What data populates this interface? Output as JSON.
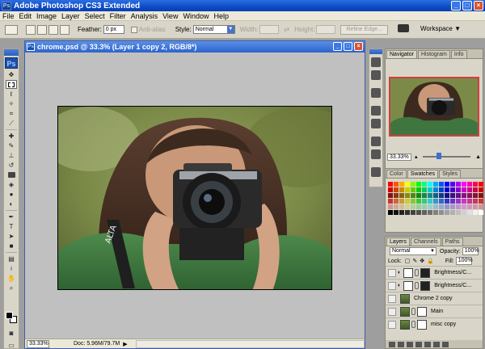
{
  "app": {
    "title": "Adobe Photoshop CS3 Extended",
    "icon": "ps-icon"
  },
  "window_buttons": {
    "minimize": "_",
    "maximize": "□",
    "close": "×"
  },
  "menu": [
    "File",
    "Edit",
    "Image",
    "Layer",
    "Select",
    "Filter",
    "Analysis",
    "View",
    "Window",
    "Help"
  ],
  "options_bar": {
    "feather_label": "Feather:",
    "feather_value": "0 px",
    "antialias_label": "Anti-alias",
    "style_label": "Style:",
    "style_value": "Normal",
    "width_label": "Width:",
    "height_label": "Height:",
    "refine_edge": "Refine Edge...",
    "workspace_label": "Workspace ▼"
  },
  "toolbox": {
    "logo": "Ps"
  },
  "document": {
    "title": "chrome.psd @ 33.3% (Layer 1 copy 2, RGB/8*)",
    "zoom": "33.33%",
    "doc_info": "Doc: 5.96M/79.7M"
  },
  "navigator_panel": {
    "tabs": [
      "Navigator",
      "Histogram",
      "Info"
    ],
    "active_tab": "Navigator",
    "zoom": "33.33%"
  },
  "swatches_panel": {
    "tabs": [
      "Color",
      "Swatches",
      "Styles"
    ],
    "active_tab": "Swatches"
  },
  "layers_panel": {
    "tabs": [
      "Layers",
      "Channels",
      "Paths"
    ],
    "active_tab": "Layers",
    "blend_mode": "Normal",
    "opacity_label": "Opacity:",
    "opacity_value": "100%",
    "lock_label": "Lock:",
    "fill_label": "Fill:",
    "fill_value": "100%",
    "layers": [
      {
        "name": "Brightness/C..."
      },
      {
        "name": "Brightness/C..."
      },
      {
        "name": "Chrome 2 copy"
      },
      {
        "name": "Main"
      },
      {
        "name": "misc copy"
      }
    ]
  },
  "colors": {
    "title_bar": "#0d4bc8",
    "panel_bg": "#d9d6c9",
    "canvas_bg": "#c0c0c0"
  }
}
